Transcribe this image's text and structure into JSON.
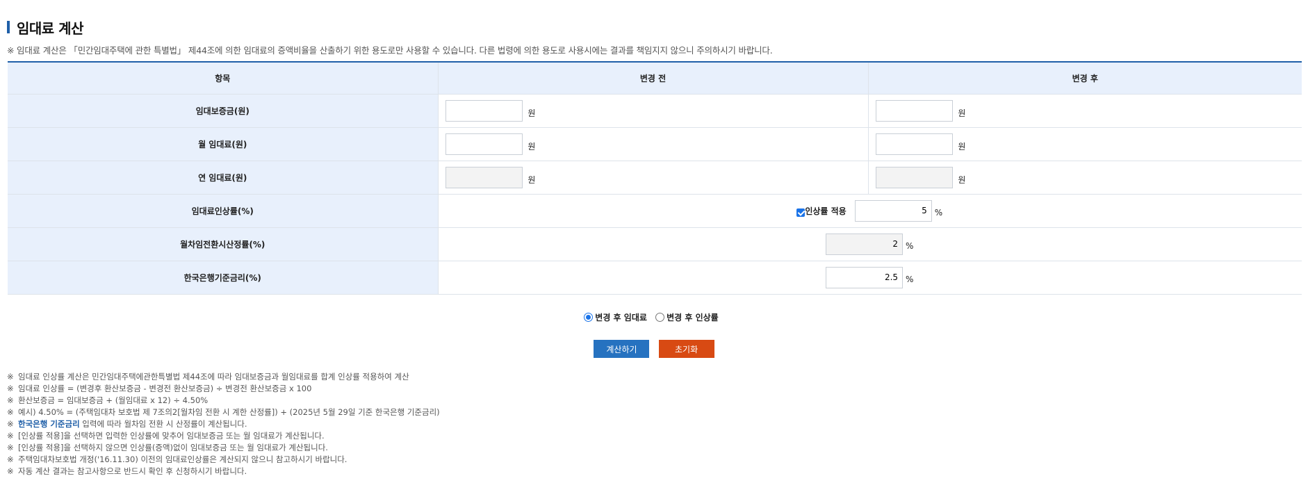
{
  "page": {
    "title": "임대료 계산",
    "notice": "※ 임대료 계산은 「민간임대주택에 관한 특별법」 제44조에 의한 임대료의 증액비율을 산출하기 위한 용도로만 사용할 수 있습니다. 다른 법령에 의한 용도로 사용시에는 결과를 책임지지 않으니 주의하시기 바랍니다."
  },
  "table": {
    "headers": [
      "항목",
      "변경 전",
      "변경 후"
    ],
    "rows": {
      "deposit": {
        "label": "임대보증금(원)",
        "unit": "원",
        "before_value": "",
        "after_value": ""
      },
      "monthly": {
        "label": "월 임대료(원)",
        "unit": "원",
        "before_value": "",
        "after_value": ""
      },
      "yearly": {
        "label": "연 임대료(원)",
        "unit": "원",
        "before_value": "",
        "after_value": ""
      },
      "increase": {
        "label": "임대료인상률(%)",
        "checkbox_label": "인상률 적용",
        "checked": true,
        "value": "5",
        "unit": "%"
      },
      "conversion": {
        "label": "월차임전환시산정률(%)",
        "value": "2",
        "unit": "%"
      },
      "base_rate": {
        "label": "한국은행기준금리(%)",
        "value": "2.5",
        "unit": "%"
      }
    }
  },
  "options": {
    "radio1": {
      "label": "변경 후 임대료",
      "selected": true
    },
    "radio2": {
      "label": "변경 후 인상률",
      "selected": false
    }
  },
  "buttons": {
    "calculate": "계산하기",
    "reset": "초기화"
  },
  "notes": {
    "mark": "※",
    "n1": "임대료 인상률 계산은 민간임대주택에관한특별법 제44조에 따라 임대보증금과 월임대료를 합계 인상률 적용하여 계산",
    "n2": "임대료 인상률 = (변경후 환산보증금 - 변경전 환산보증금) ÷ 변경전 환산보증금 x 100",
    "n3": "환산보증금 = 임대보증금 + (월임대료 x 12) ÷ 4.50%",
    "n4": "예시) 4.50% = (주택임대차 보호법 제 7조의2[월차임 전환 시 계한 산정률]) + (2025년 5월 29일 기준 한국은행 기준금리)",
    "n5_highlight": "한국은행 기준금리",
    "n5_rest": " 입력에 따라 월차임 전환 시 산정률이 계산됩니다.",
    "n6": "[인상률 적용]을 선택하면 입력한 인상률에 맞추어 임대보증금 또는 월 임대료가 계산됩니다.",
    "n7": "[인상률 적용]을 선택하지 않으면 인상률(증액)없이 임대보증금 또는 월 임대료가 계산됩니다.",
    "n8": "주택임대차보호법 개정('16.11.30) 이전의 임대료인상률은 계산되지 않으니 참고하시기 바랍니다.",
    "n9": "자동 계산 결과는 참고사항으로 반드시 확인 후 신청하시기 바랍니다."
  },
  "colors": {
    "accent": "#1f5fa8",
    "header_bg": "#e8f0fc",
    "calc_button": "#2672c0",
    "reset_button": "#d84a13"
  }
}
